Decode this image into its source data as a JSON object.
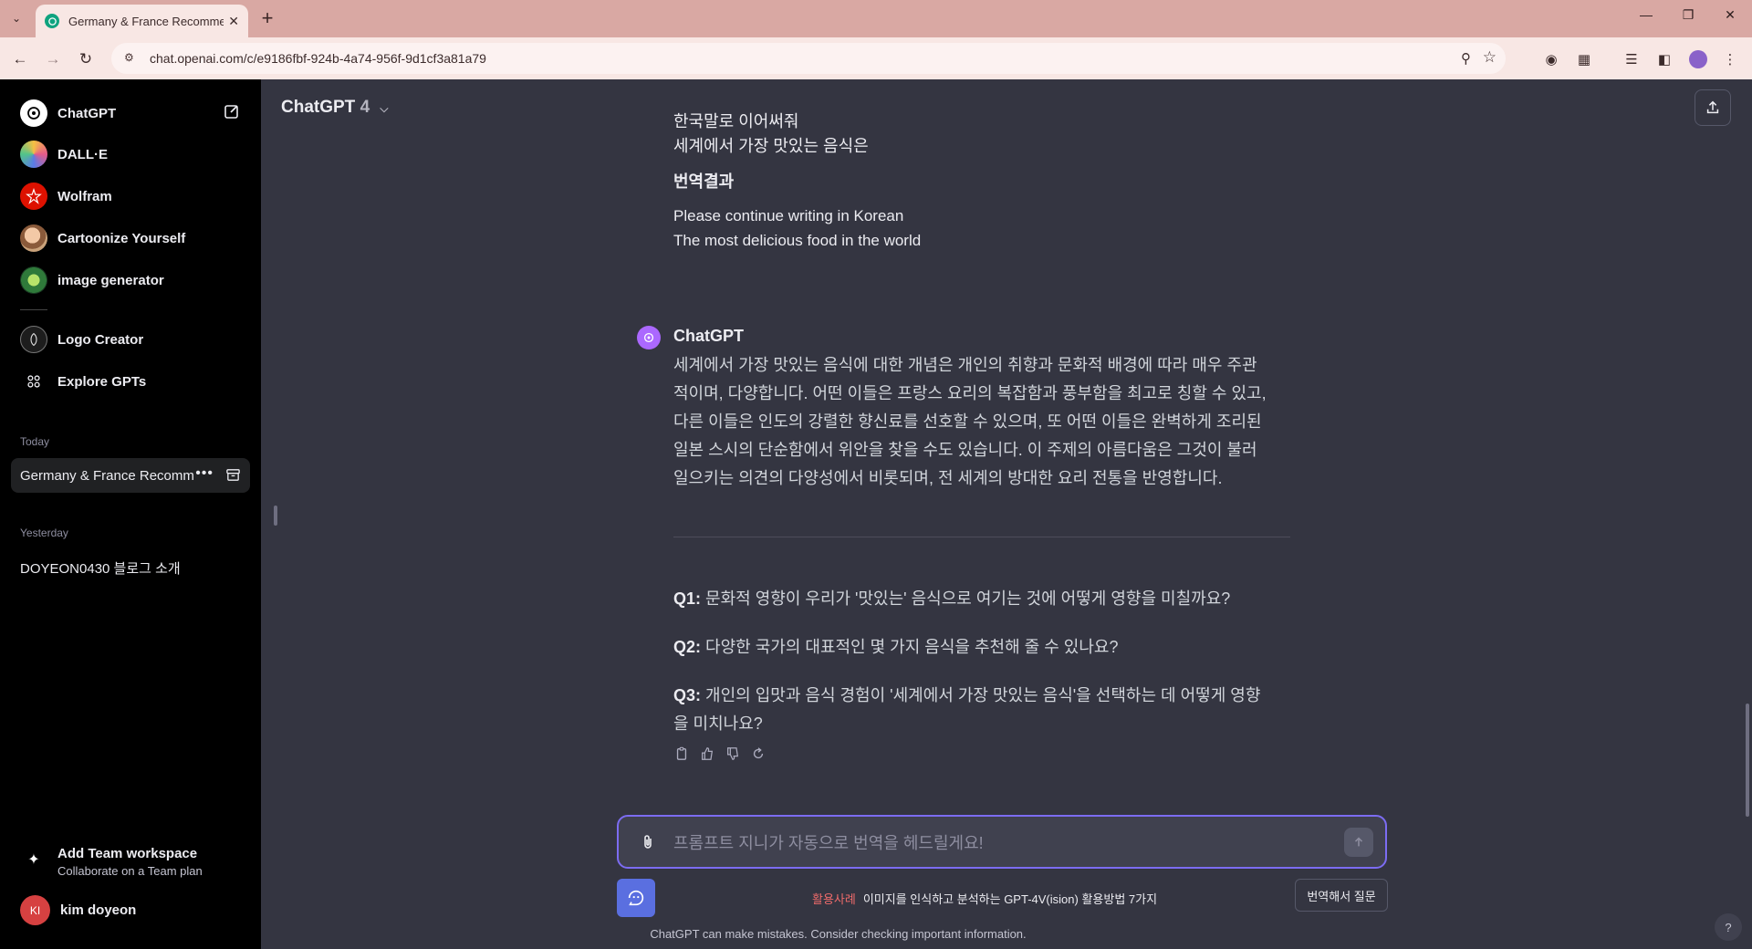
{
  "browser": {
    "tab_title": "Germany & France Recommend",
    "url": "chat.openai.com/c/e9186fbf-924b-4a74-956f-9d1cf3a81a79"
  },
  "sidebar": {
    "gpts": [
      {
        "label": "ChatGPT",
        "icon": "openai-icon"
      },
      {
        "label": "DALL·E",
        "icon": "dalle-icon"
      },
      {
        "label": "Wolfram",
        "icon": "wolfram-icon"
      },
      {
        "label": "Cartoonize Yourself",
        "icon": "cartoon-icon"
      },
      {
        "label": "image generator",
        "icon": "image-gen-icon"
      },
      {
        "label": "Logo Creator",
        "icon": "logo-creator-icon"
      },
      {
        "label": "Explore GPTs",
        "icon": "grid-icon"
      }
    ],
    "today_label": "Today",
    "active_chat": "Germany & France Recommend",
    "yesterday_label": "Yesterday",
    "yesterday_chat": "DOYEON0430 블로그 소개",
    "team_title": "Add Team workspace",
    "team_sub": "Collaborate on a Team plan",
    "user_initials": "KI",
    "user_name": "kim doyeon"
  },
  "header": {
    "model": "ChatGPT",
    "version": "4"
  },
  "conversation": {
    "user_line1": "한국말로 이어써줘",
    "user_line2": "세계에서 가장 맛있는 음식은",
    "translation_heading": "번역결과",
    "translation_line1": "Please continue writing in Korean",
    "translation_line2": "The most delicious food in the world",
    "bot_name": "ChatGPT",
    "bot_line1": "세계에서 가장 맛있는 음식에 대한 개념은 개인의 취향과 문화적 배경에 따라 매우 주관",
    "bot_line2": "적이며, 다양합니다. 어떤 이들은 프랑스 요리의 복잡함과 풍부함을 최고로 칭할 수 있고,",
    "bot_line3": "다른 이들은 인도의 강렬한 향신료를 선호할 수 있으며, 또 어떤 이들은 완벽하게 조리된",
    "bot_line4": "일본 스시의 단순함에서 위안을 찾을 수도 있습니다. 이 주제의 아름다움은 그것이 불러",
    "bot_line5": "일으키는 의견의 다양성에서 비롯되며, 전 세계의 방대한 요리 전통을 반영합니다.",
    "q1_label": "Q1:",
    "q1_text": " 문화적 영향이 우리가 '맛있는' 음식으로 여기는 것에 어떻게 영향을 미칠까요?",
    "q2_label": "Q2:",
    "q2_text": " 다양한 국가의 대표적인 몇 가지 음식을 추천해 줄 수 있나요?",
    "q3_label": "Q3:",
    "q3_line1": " 개인의 입맛과 음식 경험이 '세계에서 가장 맛있는 음식'을 선택하는 데 어떻게 영향",
    "q3_line2": "을 미치나요?"
  },
  "composer": {
    "placeholder": "프롬프트 지니가 자동으로 번역을 헤드릴게요!",
    "tip_tag": "활용사례",
    "tip_text": "이미지를 인식하고 분석하는 GPT-4V(ision) 활용방법 7가지",
    "translate_button": "번역해서 질문",
    "disclaimer": "ChatGPT can make mistakes. Consider checking important information.",
    "help": "?"
  }
}
